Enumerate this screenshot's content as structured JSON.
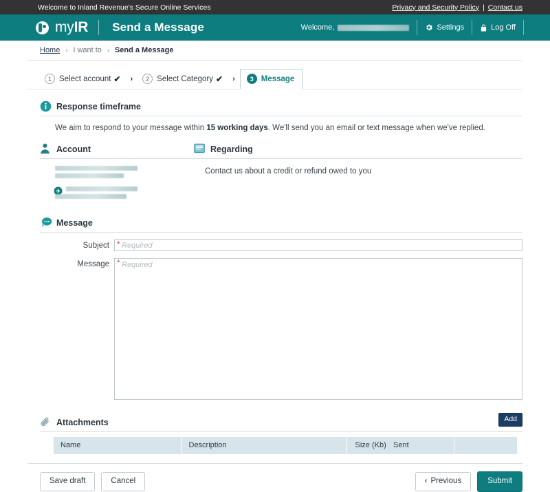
{
  "topbar": {
    "welcome_text": "Welcome to Inland Revenue's Secure Online Services",
    "privacy_link": "Privacy and Security Policy",
    "separator": "|",
    "contact_link": "Contact us"
  },
  "header": {
    "logo_text_light": "my",
    "logo_text_bold": "IR",
    "logo_icon": "myir-circle-logo-icon",
    "page_title": "Send a Message",
    "welcome_label": "Welcome,",
    "user_name_redacted": "",
    "settings_label": "Settings",
    "settings_icon": "gear-icon",
    "logoff_label": "Log Off",
    "logoff_icon": "lock-icon"
  },
  "breadcrumb": {
    "home": "Home",
    "chevron": "›",
    "i_want_to": "I want to",
    "current": "Send a Message"
  },
  "stepper": {
    "separator": "›",
    "steps": [
      {
        "num": "1",
        "label": "Select account",
        "state": "done",
        "tick": "✔"
      },
      {
        "num": "2",
        "label": "Select Category",
        "state": "done",
        "tick": "✔"
      },
      {
        "num": "3",
        "label": "Message",
        "state": "active",
        "tick": ""
      }
    ]
  },
  "response_timeframe": {
    "icon": "info-circle-icon",
    "title": "Response timeframe",
    "text_before": "We aim to respond to your message within ",
    "text_bold": "15 working days",
    "text_after": ". We'll send you an email or text message when we've replied."
  },
  "account": {
    "icon": "person-icon",
    "title": "Account",
    "rows": [
      {
        "redacted": true,
        "selected": false
      },
      {
        "redacted": true,
        "selected": true,
        "arrow_icon": "arrow-right-circle-icon"
      }
    ]
  },
  "regarding": {
    "icon": "document-icon",
    "title": "Regarding",
    "text": "Contact us about a credit or refund owed to you"
  },
  "message": {
    "icon": "chat-bubble-icon",
    "title": "Message",
    "subject": {
      "label": "Subject",
      "required_star": "*",
      "placeholder": "Required",
      "value": ""
    },
    "body": {
      "label": "Message",
      "required_star": "*",
      "placeholder": "Required",
      "value": ""
    }
  },
  "attachments": {
    "icon": "paperclip-icon",
    "title": "Attachments",
    "add_label": "Add",
    "columns": [
      "Name",
      "Description",
      "Size (Kb)",
      "Sent",
      ""
    ],
    "rows": []
  },
  "footer": {
    "save_draft_label": "Save draft",
    "cancel_label": "Cancel",
    "previous_label": "Previous",
    "previous_icon": "chevron-left-icon",
    "submit_label": "Submit"
  },
  "colors": {
    "brand_teal": "#0e7d80",
    "topbar_dark": "#333333",
    "add_button_navy": "#1b3d63",
    "table_header_blue": "#d7e4e9",
    "required_red": "#c0392b"
  }
}
